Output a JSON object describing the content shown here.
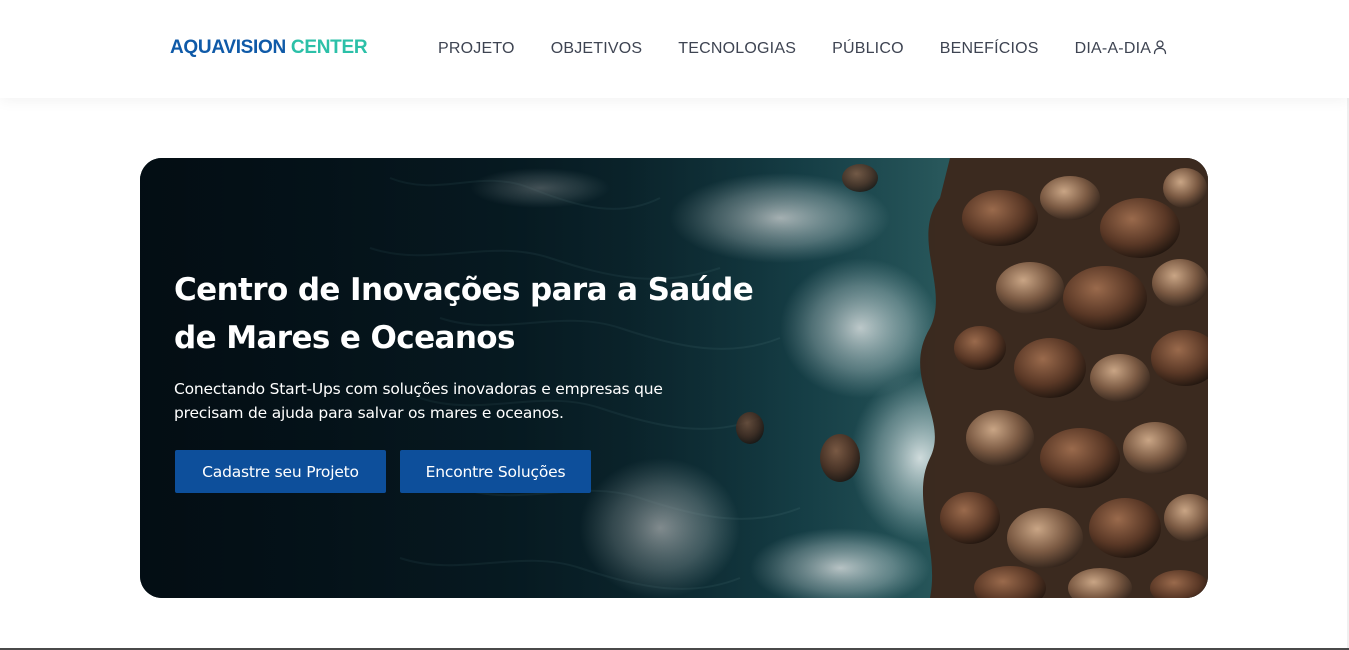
{
  "brand": {
    "part1": "AQUAVISION",
    "part2": "CENTER",
    "colors": {
      "primary": "#0f5aa8",
      "accent": "#2cc0a8"
    }
  },
  "nav": {
    "items": [
      {
        "label": "PROJETO"
      },
      {
        "label": "OBJETIVOS"
      },
      {
        "label": "TECNOLOGIAS"
      },
      {
        "label": "PÚBLICO"
      },
      {
        "label": "BENEFÍCIOS"
      },
      {
        "label": "DIA-A-DIA"
      }
    ],
    "user_icon": "user-icon"
  },
  "hero": {
    "title": "Centro de Inovações para a Saúde de Mares e Oceanos",
    "subtitle": "Conectando Start-Ups com soluções inovadoras e empresas que precisam de ajuda para salvar os mares e oceanos.",
    "primary_button": "Cadastre seu Projeto",
    "secondary_button": "Encontre Soluções",
    "button_color": "#0d4f9b",
    "background_image": "aerial-ocean-rocky-shore"
  }
}
